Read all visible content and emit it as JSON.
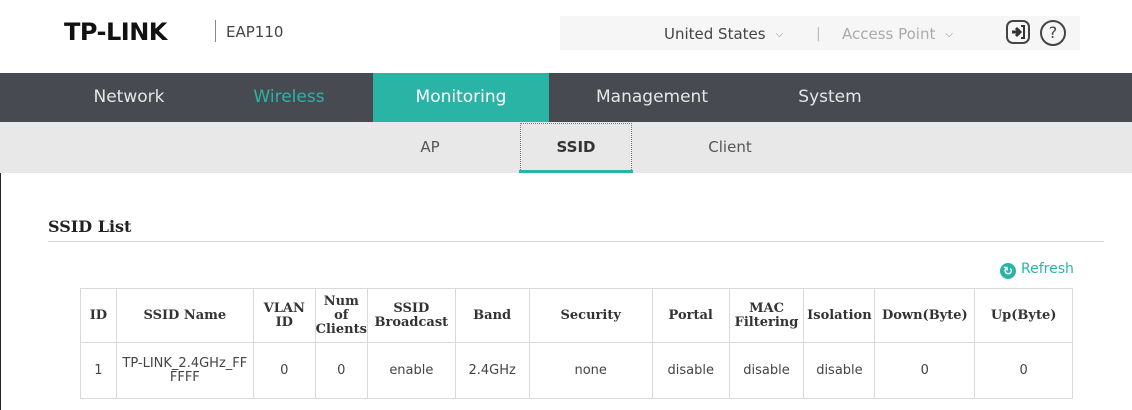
{
  "header": {
    "brand": "TP-LINK",
    "model": "EAP110",
    "region": "United States",
    "separator": "|",
    "mode": "Access Point",
    "help_glyph": "?"
  },
  "main_nav": [
    {
      "label": "Network"
    },
    {
      "label": "Wireless"
    },
    {
      "label": "Monitoring"
    },
    {
      "label": "Management"
    },
    {
      "label": "System"
    }
  ],
  "sub_nav": [
    {
      "label": "AP"
    },
    {
      "label": "SSID"
    },
    {
      "label": "Client"
    }
  ],
  "section": {
    "title": "SSID List",
    "refresh_label": "Refresh"
  },
  "table": {
    "headers": [
      "ID",
      "SSID Name",
      "VLAN ID",
      "Num of Clients",
      "SSID Broadcast",
      "Band",
      "Security",
      "Portal",
      "MAC Filtering",
      "Isolation",
      "Down(Byte)",
      "Up(Byte)"
    ],
    "rows": [
      [
        "1",
        "TP-LINK_2.4GHz_FFFFFF",
        "0",
        "0",
        "enable",
        "2.4GHz",
        "none",
        "disable",
        "disable",
        "disable",
        "0",
        "0"
      ]
    ]
  },
  "colors": {
    "accent": "#2ab4a6",
    "nav_bg": "#474b51",
    "subnav_bg": "#e8e8e8"
  }
}
